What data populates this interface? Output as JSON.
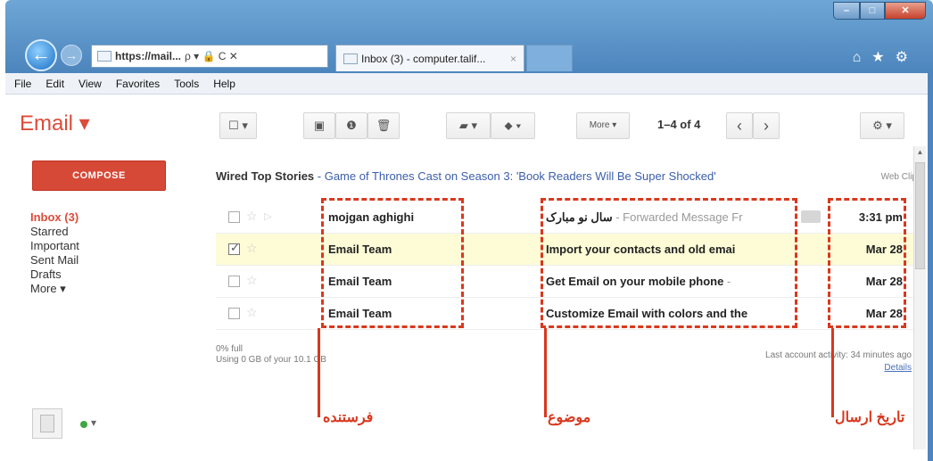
{
  "browser": {
    "address_url": "https://mail...",
    "address_controls": "ρ ▾ 🔒 C ✕",
    "tab_title": "Inbox (3) - computer.talif...",
    "tab_close": "×",
    "back": "←",
    "forward": "→",
    "right_icons": "⌂★⚙",
    "window_buttons": {
      "min": "–",
      "max": "□",
      "close": "✕"
    }
  },
  "menu": [
    "File",
    "Edit",
    "View",
    "Favorites",
    "Tools",
    "Help"
  ],
  "app": {
    "logo": "Email ▾"
  },
  "toolbar": {
    "select_label": "☐ ▾",
    "archive": "▣",
    "spam": "❶",
    "delete": "🗑",
    "move": "▰ ▾",
    "labels": "⬥ ▾",
    "more": "More ▾",
    "pager": "1–4 of 4",
    "prev": "‹",
    "next": "›",
    "settings": "⚙ ▾"
  },
  "sidebar": {
    "compose": "COMPOSE",
    "items": [
      {
        "label": "Inbox (3)",
        "active": true
      },
      {
        "label": "Starred"
      },
      {
        "label": "Important"
      },
      {
        "label": "Sent Mail"
      },
      {
        "label": "Drafts"
      },
      {
        "label": "More ▾"
      }
    ],
    "presence_dash": "▾"
  },
  "promo": {
    "source": "Wired Top Stories",
    "separator": " - ",
    "title": "Game of Thrones Cast on Season 3: 'Book Readers Will Be Super Shocked'",
    "tag": "Web Clip"
  },
  "emails": [
    {
      "sender": "mojgan aghighi",
      "subject": "سال نو مبارک",
      "snippet": " - Forwarded Message Fr",
      "date": "3:31 pm",
      "checked": false,
      "selected": false
    },
    {
      "sender": "Email Team",
      "subject": "Import your contacts and old emai",
      "snippet": "",
      "date": "Mar 28",
      "checked": true,
      "selected": true
    },
    {
      "sender": "Email Team",
      "subject": "Get Email on your mobile phone",
      "snippet": " -",
      "date": "Mar 28",
      "checked": false,
      "selected": false
    },
    {
      "sender": "Email Team",
      "subject": "Customize Email with colors and the",
      "snippet": "",
      "date": "Mar 28",
      "checked": false,
      "selected": false
    }
  ],
  "footer": {
    "usage_pct": "0% full",
    "usage": "Using 0 GB of your 10.1 GB",
    "last_activity": "Last account activity: 34 minutes ago",
    "details": "Details"
  },
  "annotations": {
    "sender": "فرستنده",
    "subject": "موضوع",
    "date": "تاریخ ارسال"
  },
  "colors": {
    "accent": "#dd4b39",
    "annotation": "#d9381e",
    "selected_row": "#fdfcd7",
    "link": "#3b5eab"
  }
}
